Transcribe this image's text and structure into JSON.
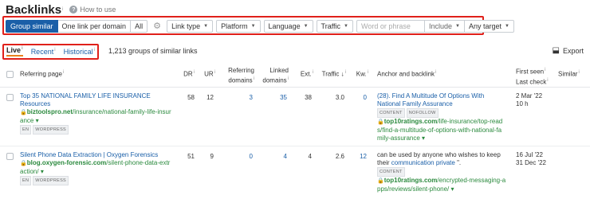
{
  "header": {
    "title": "Backlinks",
    "title_sup": "i",
    "howto_label": "How to use"
  },
  "filters": {
    "group_similar": "Group similar",
    "one_link_per_domain": "One link per domain",
    "all": "All",
    "link_type": "Link type",
    "platform": "Platform",
    "language": "Language",
    "traffic": "Traffic",
    "search_placeholder": "Word or phrase",
    "include": "Include",
    "target": "Any target"
  },
  "tabs": {
    "live": "Live",
    "recent": "Recent",
    "historical": "Historical"
  },
  "summary": "1,213 groups of similar links",
  "export_label": "Export",
  "columns": {
    "referring_page": "Referring page",
    "dr": "DR",
    "ur": "UR",
    "referring_domains_1": "Referring",
    "referring_domains_2": "domains",
    "linked_domains_1": "Linked",
    "linked_domains_2": "domains",
    "ext": "Ext.",
    "traffic": "Traffic",
    "kw": "Kw.",
    "anchor": "Anchor and backlink",
    "first_seen": "First seen",
    "last_check": "Last check",
    "similar": "Similar",
    "info": "i"
  },
  "rows": [
    {
      "title_1": "Top 35 NATIONAL FAMILY LIFE INSURANCE",
      "title_2": "Resources",
      "url_domain": "biztoolspro.net",
      "url_path_1": "/insurance/national-family-life-insur",
      "url_path_2": "ance",
      "url_caret": "▾",
      "badges": [
        "EN",
        "WORDPRESS"
      ],
      "dr": "58",
      "ur": "12",
      "ref_domains": "3",
      "linked_domains": "35",
      "ext": "38",
      "traffic": "3.0",
      "kw": "0",
      "anchor_1": "(28). Find A Multitude Of Options With",
      "anchor_2": "National Family Assurance",
      "anchor_badges": [
        "CONTENT",
        "NOFOLLOW"
      ],
      "backlink_domain": "top10ratings.com",
      "backlink_path_1": "/life-insurance/top-read",
      "backlink_path_2": "s/find-a-multitude-of-options-with-national-fa",
      "backlink_path_3": "mily-assurance",
      "first_seen": "2 Mar '22",
      "last_check": "10 h"
    },
    {
      "title_1": "Silent Phone Data Extraction | Oxygen Forensics",
      "url_domain": "blog.oxygen-forensic.com",
      "url_path_1": "/silent-phone-data-extr",
      "url_path_2": "action/",
      "url_caret": "▾",
      "badges": [
        "EN",
        "WORDPRESS"
      ],
      "dr": "51",
      "ur": "9",
      "ref_domains": "0",
      "linked_domains": "4",
      "ext": "4",
      "traffic": "2.6",
      "kw": "12",
      "anchor_1": "can be used by anyone who wishes to keep",
      "anchor_2_pre": "their ",
      "anchor_2_link": "communication private",
      "anchor_2_post": " \".",
      "anchor_badges": [
        "CONTENT"
      ],
      "backlink_domain": "top10ratings.com",
      "backlink_path_1": "/encrypted-messaging-a",
      "backlink_path_2": "pps/reviews/silent-phone/",
      "first_seen": "16 Jul '22",
      "last_check": "31 Dec '22"
    }
  ],
  "colors": {
    "accent": "#1a5fa8",
    "highlight_box": "#e0201a",
    "url_green": "#2b8a3e",
    "tab_underline": "#e8831e"
  }
}
